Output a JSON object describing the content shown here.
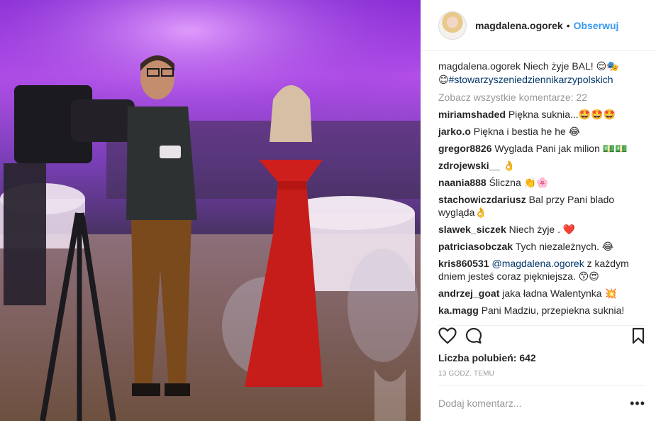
{
  "post": {
    "username": "magdalena.ogorek",
    "separator": "•",
    "follow_label": "Obserwuj"
  },
  "caption": {
    "author": "magdalena.ogorek",
    "text": "Niech żyje BAL!",
    "emoji_a": "😌🎭",
    "emoji_b": "😊",
    "hashtag": "#stowarzyszeniedziennikarzypolskich"
  },
  "view_all_label": "Zobacz wszystkie komentarze: 22",
  "comments": [
    {
      "author": "miriamshaded",
      "text": "Piękna suknia...🤩🤩🤩"
    },
    {
      "author": "jarko.o",
      "text": "Piękna i bestia he he 😂"
    },
    {
      "author": "gregor8826",
      "text": "Wyglada Pani jak milion 💵💵"
    },
    {
      "author": "zdrojewski__",
      "text": "👌"
    },
    {
      "author": "naania888",
      "text": "Śliczna 👏🌸"
    },
    {
      "author": "stachowiczdariusz",
      "text": "Bal przy Pani blado wygląda👌"
    },
    {
      "author": "slawek_siczek",
      "text": "Niech żyje . ❤️"
    },
    {
      "author": "patriciasobczak",
      "text": "Tych niezależnych. 😂"
    },
    {
      "author": "kris860531",
      "mention": "@magdalena.ogorek",
      "text": "z każdym dniem jesteś coraz piękniejsza. 😙😍"
    },
    {
      "author": "andrzej_goat",
      "text": "jaka ładna Walentynka 💥"
    },
    {
      "author": "ka.magg",
      "text": "Pani Madziu, przepiekna suknia!"
    }
  ],
  "icons": {
    "like": "heart-icon",
    "comment": "speech-bubble-icon",
    "save": "bookmark-icon",
    "more": "more-dots-icon"
  },
  "likes_label": "Liczba polubień: 642",
  "timestamp": "13 GODZ. TEMU",
  "add_comment": {
    "placeholder": "Dodaj komentarz...",
    "more_label": "•••"
  },
  "colors": {
    "link": "#3897f0",
    "mention": "#003569",
    "muted": "#999999",
    "text": "#262626"
  }
}
